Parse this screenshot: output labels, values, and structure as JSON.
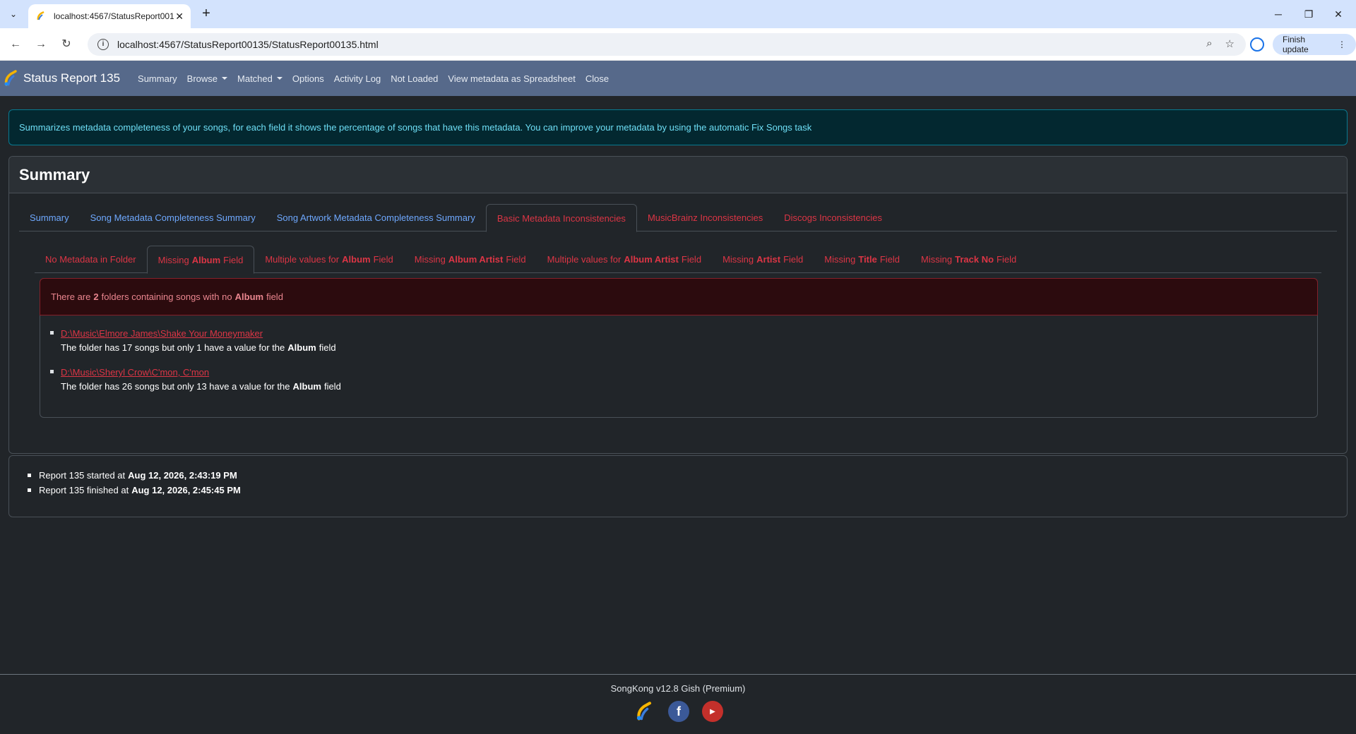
{
  "browser": {
    "tab_title": "localhost:4567/StatusReport00135",
    "url": "localhost:4567/StatusReport00135/StatusReport00135.html",
    "finish_update_label": "Finish update"
  },
  "navbar": {
    "brand": "Status Report 135",
    "items": [
      {
        "label": "Summary"
      },
      {
        "label": "Browse"
      },
      {
        "label": "Matched"
      },
      {
        "label": "Options"
      },
      {
        "label": "Activity Log"
      },
      {
        "label": "Not Loaded"
      },
      {
        "label": "View metadata as Spreadsheet"
      },
      {
        "label": "Close"
      }
    ]
  },
  "info_alert": "Summarizes metadata completeness of your songs, for each field it shows the percentage of songs that have this metadata. You can improve your metadata by using the automatic Fix Songs task",
  "card": {
    "title": "Summary",
    "tabs": [
      {
        "label": "Summary"
      },
      {
        "label": "Song Metadata Completeness Summary"
      },
      {
        "label": "Song Artwork Metadata Completeness Summary"
      },
      {
        "label": "Basic Metadata Inconsistencies"
      },
      {
        "label": "MusicBrainz Inconsistencies"
      },
      {
        "label": "Discogs Inconsistencies"
      }
    ],
    "subtabs": [
      {
        "pre": "No Metadata in Folder",
        "bold": "",
        "post": ""
      },
      {
        "pre": "Missing",
        "bold": "Album",
        "post": "Field"
      },
      {
        "pre": "Multiple values for",
        "bold": "Album",
        "post": "Field"
      },
      {
        "pre": "Missing",
        "bold": "Album Artist",
        "post": "Field"
      },
      {
        "pre": "Multiple values for",
        "bold": "Album Artist",
        "post": "Field"
      },
      {
        "pre": "Missing",
        "bold": "Artist",
        "post": "Field"
      },
      {
        "pre": "Missing",
        "bold": "Title",
        "post": "Field"
      },
      {
        "pre": "Missing",
        "bold": "Track No",
        "post": "Field"
      }
    ],
    "alert": {
      "pre": "There are",
      "count": "2",
      "mid": "folders containing songs with no",
      "field": "Album",
      "post": "field"
    },
    "folders": [
      {
        "path": "D:\\Music\\Elmore James\\Shake Your Moneymaker",
        "pre": "The folder has 17 songs but only 1 have a value for the",
        "field": "Album",
        "post": "field"
      },
      {
        "path": "D:\\Music\\Sheryl Crow\\C'mon, C'mon",
        "pre": "The folder has 26 songs but only 13 have a value for the",
        "field": "Album",
        "post": "field"
      }
    ]
  },
  "report_times": [
    {
      "label": "Report 135 started at",
      "value": "Aug 12, 2026, 2:43:19 PM"
    },
    {
      "label": "Report 135 finished at",
      "value": "Aug 12, 2026, 2:45:45 PM"
    }
  ],
  "footer": {
    "text": "SongKong v12.8 Gish (Premium)",
    "icons": [
      "songkong-icon",
      "facebook-icon",
      "youtube-icon"
    ]
  },
  "colors": {
    "navbar_bg": "#56698a",
    "page_bg": "#212529",
    "link_blue": "#6ea8fe",
    "danger": "#dc3545",
    "info_text": "#6edff6"
  }
}
